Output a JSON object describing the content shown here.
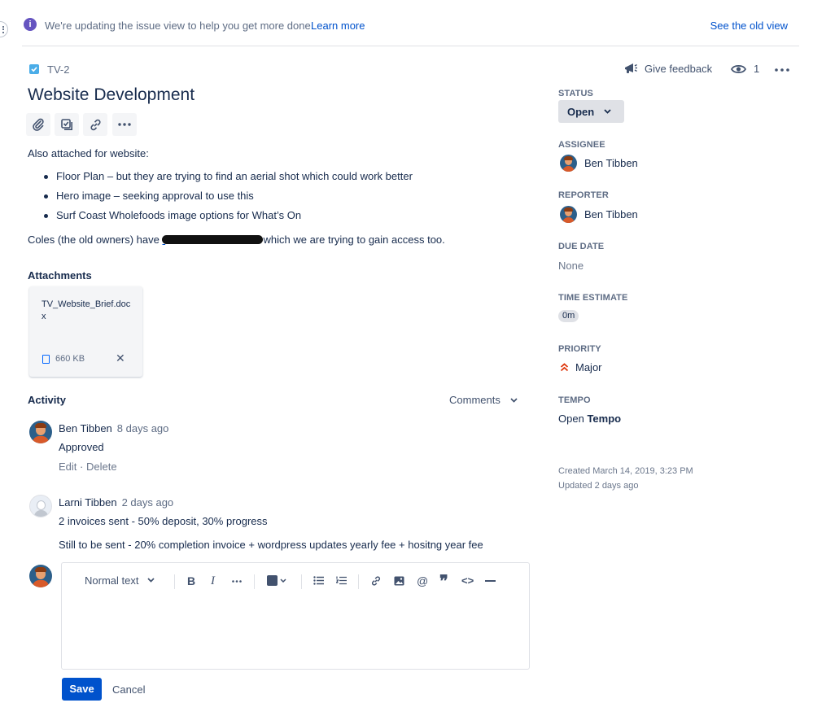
{
  "banner": {
    "message": "We're updating the issue view to help you get more done.",
    "learn_more": "Learn more",
    "old_view": "See the old view"
  },
  "issue": {
    "key": "TV-2",
    "title": "Website Development",
    "description_intro": "Also attached for website:",
    "bullets": [
      "Floor Plan – but they are trying to find an aerial shot which could work better",
      "Hero image – seeking approval to use this",
      "Surf Coast Wholefoods image options for What’s On"
    ],
    "coles_prefix": "Coles (the old owners) have",
    "coles_suffix": "which we are trying to gain access too."
  },
  "header": {
    "give_feedback": "Give feedback",
    "watchers": "1"
  },
  "attachments": {
    "heading": "Attachments",
    "items": [
      {
        "name": "TV_Website_Brief.docx",
        "size": "660 KB"
      }
    ]
  },
  "activity": {
    "heading": "Activity",
    "filter": "Comments",
    "comments": [
      {
        "author": "Ben Tibben",
        "time": "8 days ago",
        "body": [
          "Approved"
        ],
        "actions": [
          "Edit",
          "Delete"
        ]
      },
      {
        "author": "Larni Tibben",
        "time": "2 days ago",
        "body": [
          "2 invoices sent - 50% deposit, 30% progress",
          "Still to be sent - 20% completion invoice + wordpress updates yearly fee + hositng year fee"
        ]
      }
    ]
  },
  "editor": {
    "text_style": "Normal text",
    "save": "Save",
    "cancel": "Cancel"
  },
  "sidebar": {
    "status_label": "STATUS",
    "status_value": "Open",
    "assignee_label": "ASSIGNEE",
    "assignee": "Ben Tibben",
    "reporter_label": "REPORTER",
    "reporter": "Ben Tibben",
    "due_label": "DUE DATE",
    "due_value": "None",
    "estimate_label": "TIME ESTIMATE",
    "estimate_value": "0m",
    "priority_label": "PRIORITY",
    "priority_value": "Major",
    "tempo_label": "TEMPO",
    "tempo_open": "Open",
    "tempo_name": "Tempo",
    "created": "Created March 14, 2019, 3:23 PM",
    "updated": "Updated 2 days ago"
  },
  "colors": {
    "link": "#0052cc",
    "priority_major": "#de350b",
    "info": "#6554c0"
  }
}
